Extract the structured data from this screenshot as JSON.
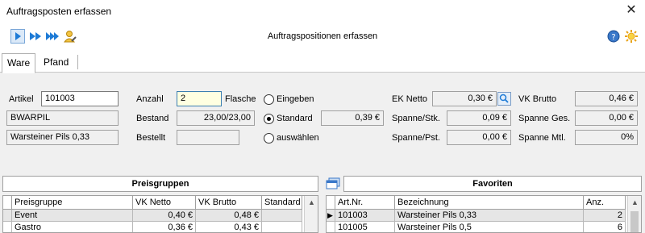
{
  "window": {
    "title": "Auftragsposten erfassen",
    "close_glyph": "✕"
  },
  "toolbar": {
    "caption": "Auftragspositionen erfassen",
    "icons": [
      "play-icon",
      "fast-forward-icon",
      "skip-forward-icon",
      "edit-user-icon",
      "help-icon",
      "settings-sun-icon"
    ]
  },
  "tabs": [
    {
      "label": "Ware",
      "active": true
    },
    {
      "label": "Pfand",
      "active": false
    }
  ],
  "form": {
    "artikel_label": "Artikel",
    "artikel_value": "101003",
    "article_code": "BWARPIL",
    "article_name": "Warsteiner Pils 0,33",
    "anzahl_label": "Anzahl",
    "anzahl_value": "2",
    "unit_label": "Flasche",
    "bestand_label": "Bestand",
    "bestand_value": "23,00/23,00",
    "bestellt_label": "Bestellt",
    "bestellt_value": "",
    "radio_eingeben": "Eingeben",
    "radio_standard": "Standard",
    "radio_auswaehlen": "auswählen",
    "radio_selected": "standard",
    "standard_price": "0,39 €",
    "ek_netto_label": "EK Netto",
    "ek_netto_value": "0,30 €",
    "spanne_stk_label": "Spanne/Stk.",
    "spanne_stk_value": "0,09 €",
    "spanne_pst_label": "Spanne/Pst.",
    "spanne_pst_value": "0,00 €",
    "vk_brutto_label": "VK Brutto",
    "vk_brutto_value": "0,46 €",
    "spanne_ges_label": "Spanne Ges.",
    "spanne_ges_value": "0,00 €",
    "spanne_mtl_label": "Spanne Mtl.",
    "spanne_mtl_value": "0%"
  },
  "preisgruppen": {
    "title": "Preisgruppen",
    "columns": [
      "Preisgruppe",
      "VK Netto",
      "VK Brutto",
      "Standard"
    ],
    "rows": [
      [
        "Event",
        "0,40 €",
        "0,48 €",
        ""
      ],
      [
        "Gastro",
        "0,36 €",
        "0,43 €",
        ""
      ]
    ]
  },
  "favoriten": {
    "title": "Favoriten",
    "columns": [
      "Art.Nr.",
      "Bezeichnung",
      "Anz."
    ],
    "rows": [
      [
        "101003",
        "Warsteiner Pils 0,33",
        "2"
      ],
      [
        "101005",
        "Warsteiner Pils 0,5",
        "6"
      ]
    ]
  },
  "colors": {
    "accent_blue": "#1e7bd6",
    "field_focus_yellow": "#ffffe1",
    "row_selected": "#e6e6e6"
  }
}
